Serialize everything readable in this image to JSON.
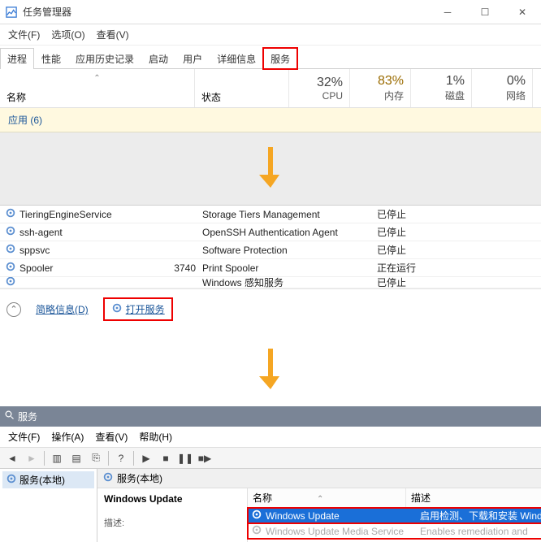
{
  "tm": {
    "title": "任务管理器",
    "menu": {
      "file": "文件(F)",
      "options": "选项(O)",
      "view": "查看(V)"
    },
    "tabs": {
      "processes": "进程",
      "performance": "性能",
      "apphistory": "应用历史记录",
      "startup": "启动",
      "users": "用户",
      "details": "详细信息",
      "services": "服务"
    },
    "cols": {
      "name": "名称",
      "status": "状态",
      "cpu_pct": "32%",
      "cpu": "CPU",
      "mem_pct": "83%",
      "mem": "内存",
      "disk_pct": "1%",
      "disk": "磁盘",
      "net_pct": "0%",
      "net": "网络"
    },
    "apps_group": "应用 (6)",
    "procs": [
      {
        "name": "TieringEngineService",
        "pid": "",
        "desc": "Storage Tiers Management",
        "status": "已停止"
      },
      {
        "name": "ssh-agent",
        "pid": "",
        "desc": "OpenSSH Authentication Agent",
        "status": "已停止"
      },
      {
        "name": "sppsvc",
        "pid": "",
        "desc": "Software Protection",
        "status": "已停止"
      },
      {
        "name": "Spooler",
        "pid": "3740",
        "desc": "Print Spooler",
        "status": "正在运行"
      },
      {
        "name": "",
        "pid": "",
        "desc": "Windows 感知服务",
        "status": "已停止"
      }
    ],
    "footer": {
      "brief": "简略信息(D)",
      "open_services": "打开服务"
    }
  },
  "svc": {
    "title": "服务",
    "menu": {
      "file": "文件(F)",
      "action": "操作(A)",
      "view": "查看(V)",
      "help": "帮助(H)"
    },
    "tree_root": "服务(本地)",
    "panel_title": "服务(本地)",
    "selected_name": "Windows Update",
    "selected_meta": "描述:",
    "cols": {
      "name": "名称",
      "desc": "描述"
    },
    "rows": [
      {
        "name": "Windows Update",
        "desc": "启用检测、下载和安装 Wind",
        "selected": true
      },
      {
        "name": "Windows Update Media Service",
        "desc": "Enables remediation and",
        "dim": true
      }
    ]
  }
}
